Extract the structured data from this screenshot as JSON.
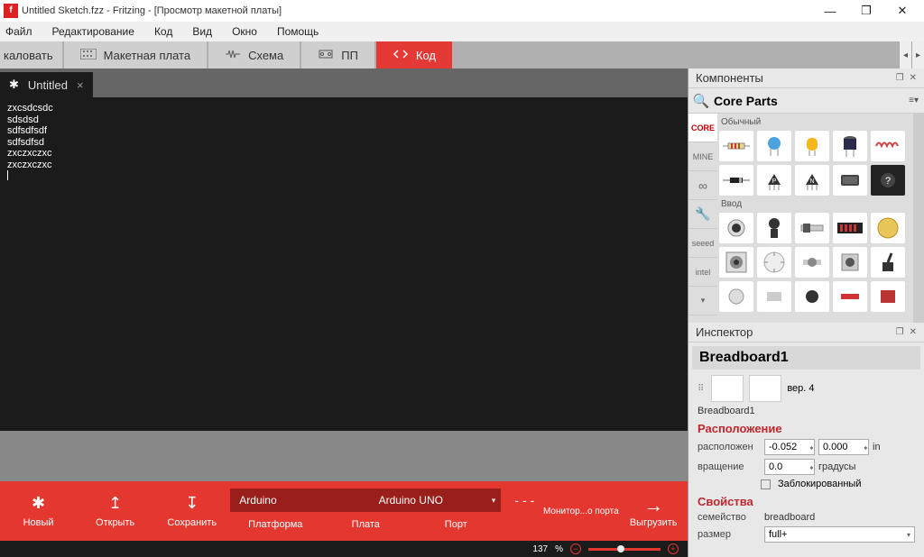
{
  "titlebar": {
    "app_icon": "f",
    "title": "Untitled Sketch.fzz - Fritzing - [Просмотр макетной платы]"
  },
  "window_buttons": {
    "min": "—",
    "max": "❐",
    "close": "✕"
  },
  "menu": {
    "file": "Файл",
    "edit": "Редактирование",
    "code": "Код",
    "view": "Вид",
    "window": "Окно",
    "help": "Помощь"
  },
  "views": {
    "welcome_partial": "каловать",
    "breadboard": "Макетная плата",
    "schematic": "Схема",
    "pcb": "ПП",
    "code": "Код",
    "arrow_left": "◂",
    "arrow_right": "▸"
  },
  "code_tab": {
    "name": "Untitled",
    "star": "✱",
    "close": "×"
  },
  "editor_text": "zxcsdcsdc\nsdsdsd\nsdfsdfsdf\nsdfsdfsd\nzxczxczxc\nzxczxczxc",
  "bottom": {
    "new": "Новый",
    "open": "Открыть",
    "save": "Сохранить",
    "platform_val": "Arduino",
    "board_val": "Arduino UNO",
    "port_val": "- - -",
    "platform_lbl": "Платформа",
    "board_lbl": "Плата",
    "port_lbl": "Порт",
    "monitor": "Монитор...о порта",
    "upload": "Выгрузить",
    "arrow": "→",
    "new_icon": "✱",
    "open_icon": "↥",
    "save_icon": "↧"
  },
  "status": {
    "zoom": "137",
    "pct": "%",
    "minus": "−",
    "plus": "+"
  },
  "panels": {
    "components": "Компоненты",
    "core_parts": "Core Parts",
    "section_basic": "Обычный",
    "section_input": "Ввод",
    "tabs": {
      "core": "CORE",
      "mine": "MINE",
      "arduino": "∞",
      "tool": "🔧",
      "seeed": "seeed",
      "intel": "intel",
      "more": "▾"
    },
    "inspector": "Инспектор",
    "insp": {
      "name": "Breadboard1",
      "version": "вер. 4",
      "subname": "Breadboard1",
      "location_head": "Расположение",
      "placed_lbl": "расположен",
      "x": "-0.052",
      "y": "0.000",
      "unit": "in",
      "rotation_lbl": "вращение",
      "rot": "0.0",
      "rot_unit": "градусы",
      "locked": "Заблокированный",
      "props_head": "Свойства",
      "family_lbl": "семейство",
      "family_val": "breadboard",
      "size_lbl": "размер",
      "size_val": "full+"
    }
  }
}
